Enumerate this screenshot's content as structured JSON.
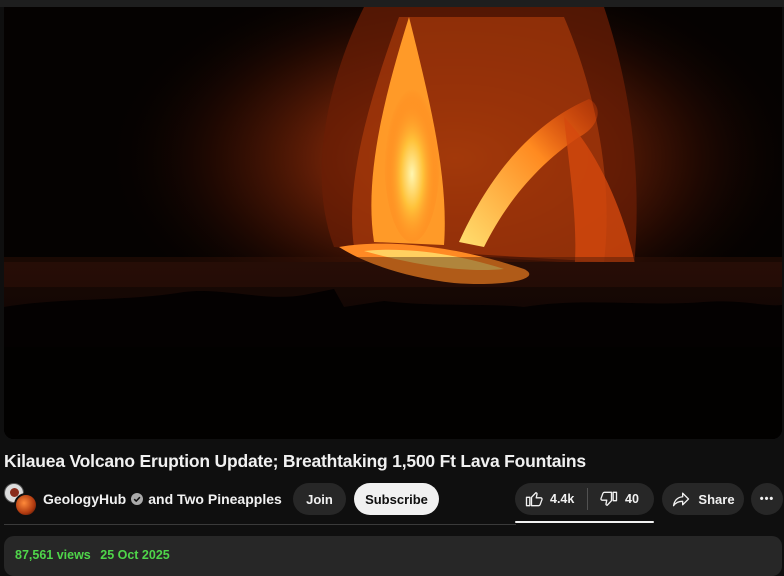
{
  "video": {
    "title": "Kilauea Volcano Eruption Update; Breathtaking 1,500 Ft Lava Fountains"
  },
  "owner": {
    "channel_name": "GeologyHub",
    "collab_text": "and Two Pineapples",
    "verified": true,
    "join_label": "Join",
    "subscribe_label": "Subscribe"
  },
  "actions": {
    "like_count": "4.4k",
    "dislike_count": "40",
    "share_label": "Share",
    "more_label": "•••"
  },
  "description": {
    "views": "87,561 views",
    "date": "25 Oct 2025"
  },
  "icons": {
    "like": "thumbs-up-icon",
    "dislike": "thumbs-down-icon",
    "share": "share-arrow-icon",
    "more": "more-horizontal-icon",
    "verified": "verified-check-icon"
  },
  "colors": {
    "background": "#0f0f0f",
    "pill": "#272727",
    "subscribe_bg": "#f1f1f1",
    "meta_highlight": "#4fd64a"
  }
}
